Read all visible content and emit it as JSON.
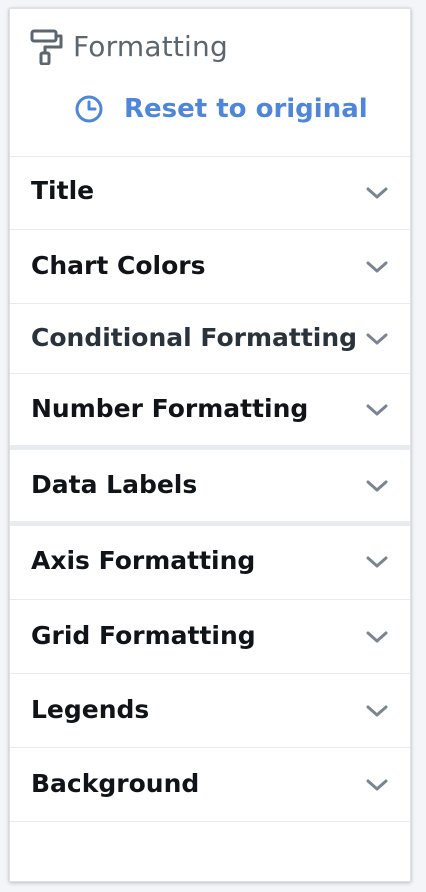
{
  "panel": {
    "title": "Formatting",
    "title_icon": "paint-roller-icon",
    "reset_icon": "clock-icon",
    "reset_label": "Reset to original",
    "accent_color": "#4f86d9"
  },
  "sections": [
    {
      "label": "Title",
      "icon": "chevron-down-icon"
    },
    {
      "label": "Chart Colors",
      "icon": "chevron-down-icon"
    },
    {
      "label": "Conditional Formatting",
      "icon": "chevron-down-icon"
    },
    {
      "label": "Number Formatting",
      "icon": "chevron-down-icon"
    },
    {
      "label": "Data Labels",
      "icon": "chevron-down-icon"
    },
    {
      "label": "Axis Formatting",
      "icon": "chevron-down-icon"
    },
    {
      "label": "Grid Formatting",
      "icon": "chevron-down-icon"
    },
    {
      "label": "Legends",
      "icon": "chevron-down-icon"
    },
    {
      "label": "Background",
      "icon": "chevron-down-icon"
    }
  ]
}
